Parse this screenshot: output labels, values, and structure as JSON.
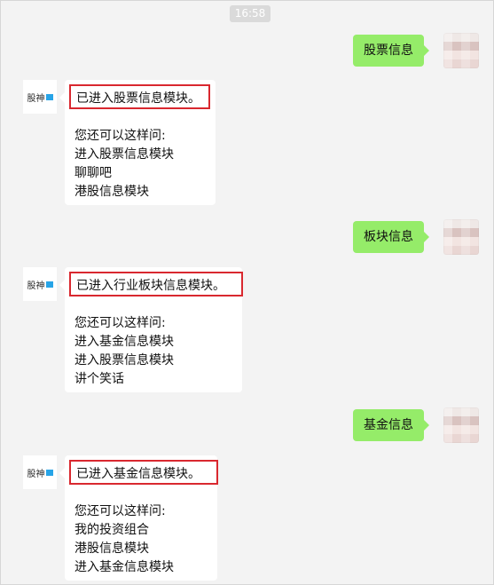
{
  "timestamp": "16:58",
  "messages": [
    {
      "user": "股票信息",
      "bot": {
        "headline": "已进入股票信息模块。",
        "prompt": "您还可以这样问:",
        "suggestions": [
          "进入股票信息模块",
          "聊聊吧",
          "港股信息模块"
        ]
      }
    },
    {
      "user": "板块信息",
      "bot": {
        "headline": "已进入行业板块信息模块。",
        "prompt": "您还可以这样问:",
        "suggestions": [
          "进入基金信息模块",
          "进入股票信息模块",
          "讲个笑话"
        ]
      }
    },
    {
      "user": "基金信息",
      "bot": {
        "headline": "已进入基金信息模块。",
        "prompt": "您还可以这样问:",
        "suggestions": [
          "我的投资组合",
          "港股信息模块",
          "进入基金信息模块"
        ]
      }
    }
  ],
  "bot_logo_text": "股神",
  "colors": {
    "user_bubble": "#95ec69",
    "highlight_box": "#d9282f",
    "logo_accent": "#27a4e7"
  }
}
